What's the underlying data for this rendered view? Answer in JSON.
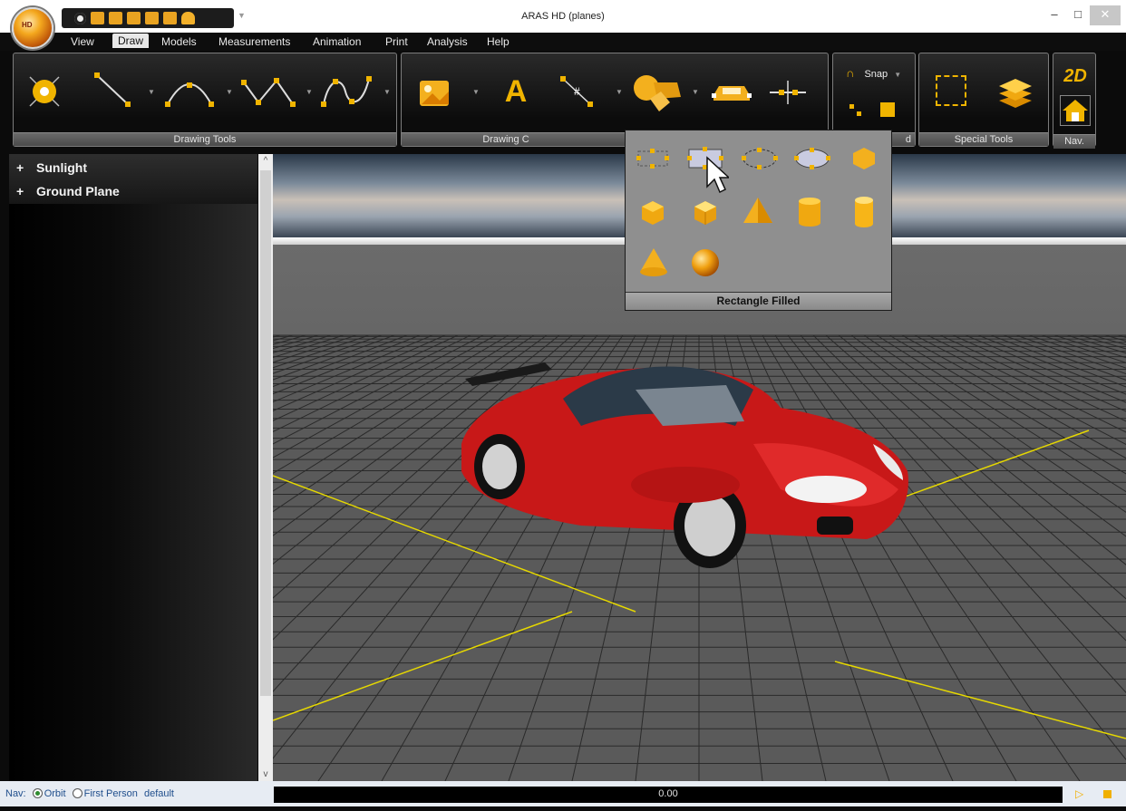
{
  "window": {
    "title": "ARAS HD (planes)",
    "min": "–",
    "max": "□",
    "close": "✕"
  },
  "app_orb": {
    "label": "HD"
  },
  "menu": {
    "items": [
      "View",
      "Draw",
      "Models",
      "Measurements",
      "Animation",
      "Print",
      "Analysis",
      "Help"
    ],
    "active": "Draw"
  },
  "ribbon": {
    "drawing_tools": {
      "label": "Drawing Tools"
    },
    "drawing_objects": {
      "label": "Drawing C",
      "text_tool": "A"
    },
    "snap": {
      "label": "Snap",
      "group_label": "d"
    },
    "special_tools": {
      "label": "Special Tools"
    },
    "nav": {
      "label": "Nav.",
      "mode": "2D"
    }
  },
  "tree": {
    "items": [
      {
        "expander": "+",
        "label": "Sunlight"
      },
      {
        "expander": "+",
        "label": "Ground Plane"
      }
    ]
  },
  "scrollbar": {
    "up": "^",
    "down": "v"
  },
  "popup": {
    "selected_label": "Rectangle Filled"
  },
  "statusbar": {
    "nav_label": "Nav:",
    "orbit": "Orbit",
    "first_person": "First Person",
    "preset": "default",
    "time": "0.00",
    "play": "▷"
  },
  "colors": {
    "accent": "#f0b400",
    "car": "#d41c1c",
    "ribbon_bg": "#0b0b0b"
  }
}
